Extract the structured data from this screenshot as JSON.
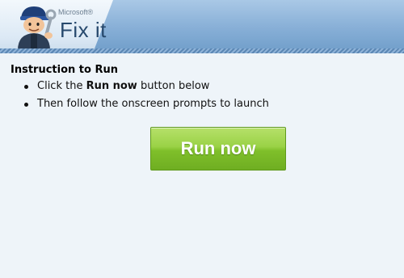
{
  "header": {
    "brand_small": "Microsoft®",
    "brand_big": "Fix it",
    "mascot_icon": "mechanic-mascot-icon",
    "colors": {
      "band": "#86aed6",
      "text": "#27496d"
    }
  },
  "instructions": {
    "title": "Instruction to Run",
    "steps": [
      {
        "prefix": "Click the ",
        "bold": "Run now",
        "suffix": " button below"
      },
      {
        "prefix": "Then follow the onscreen prompts to launch",
        "bold": "",
        "suffix": ""
      }
    ]
  },
  "run_button": {
    "label": "Run now",
    "color": "#8cc63f"
  }
}
